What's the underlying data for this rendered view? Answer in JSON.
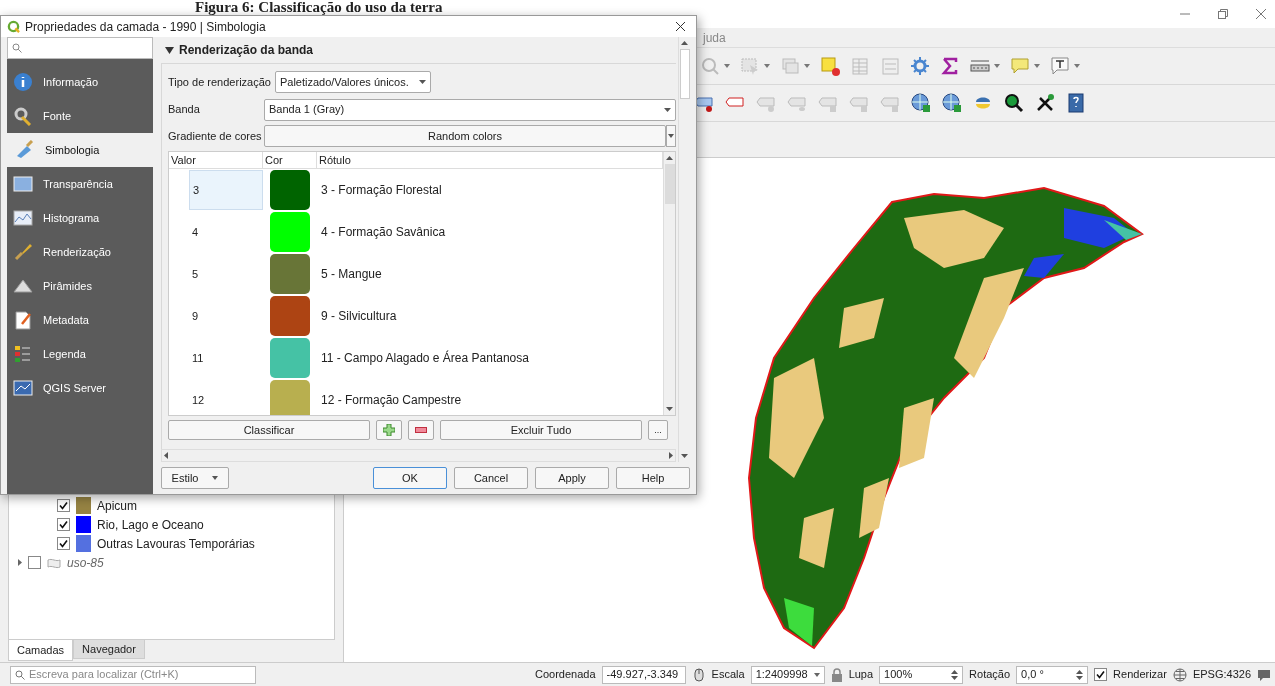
{
  "caption": "Figura 6: Classificação do uso da terra",
  "main_window": {
    "menu_fragment": "juda",
    "layers": [
      {
        "label": "Apicum",
        "checked": true,
        "color": "#968343"
      },
      {
        "label": "Rio, Lago e Oceano",
        "checked": true,
        "color": "#0000ff"
      },
      {
        "label": "Outras Lavouras Temporárias",
        "checked": true,
        "color": "#5470e0"
      }
    ],
    "layer_group": {
      "label": "uso-85",
      "checked": false,
      "expanded": false
    },
    "panel_tabs": [
      {
        "label": "Camadas",
        "selected": true
      },
      {
        "label": "Navegador",
        "selected": false
      }
    ],
    "locator": {
      "placeholder": "Escreva para localizar (Ctrl+K)"
    },
    "status_bar": {
      "coordinate_label": "Coordenada",
      "coordinate": "-49.927,-3.349",
      "scale_label": "Escala",
      "scale": "1:2409998",
      "magnifier_label": "Lupa",
      "magnifier": "100%",
      "rotation_label": "Rotação",
      "rotation": "0,0 °",
      "render": {
        "label": "Renderizar",
        "checked": true
      },
      "crs": "EPSG:4326"
    }
  },
  "dialog": {
    "title": "Propriedades da camada - 1990 | Simbologia",
    "sidebar": [
      {
        "label": "Informação",
        "selected": false
      },
      {
        "label": "Fonte",
        "selected": false
      },
      {
        "label": "Simbologia",
        "selected": true
      },
      {
        "label": "Transparência",
        "selected": false
      },
      {
        "label": "Histograma",
        "selected": false
      },
      {
        "label": "Renderização",
        "selected": false
      },
      {
        "label": "Pirâmides",
        "selected": false
      },
      {
        "label": "Metadata",
        "selected": false
      },
      {
        "label": "Legenda",
        "selected": false
      },
      {
        "label": "QGIS Server",
        "selected": false
      }
    ],
    "section": {
      "title": "Renderização da banda",
      "expanded": true
    },
    "render_type": {
      "label": "Tipo de renderização",
      "value": "Paletizado/Valores únicos."
    },
    "band": {
      "label": "Banda",
      "value": "Banda 1 (Gray)"
    },
    "gradient": {
      "label": "Gradiente de cores",
      "value": "Random colors"
    },
    "table": {
      "columns": [
        "Valor",
        "Cor",
        "Rótulo"
      ],
      "rows": [
        {
          "value": "3",
          "color": "#006400",
          "label": "3 - Formação Florestal",
          "selected": true
        },
        {
          "value": "4",
          "color": "#00ff00",
          "label": "4 - Formação Savânica",
          "selected": false
        },
        {
          "value": "5",
          "color": "#687537",
          "label": "5 - Mangue",
          "selected": false
        },
        {
          "value": "9",
          "color": "#ad4413",
          "label": "9 - Silvicultura",
          "selected": false
        },
        {
          "value": "11",
          "color": "#45c2a5",
          "label": "11 - Campo Alagado e Área Pantanosa",
          "selected": false
        },
        {
          "value": "12",
          "color": "#b8af4f",
          "label": "12 - Formação Campestre",
          "selected": false
        }
      ]
    },
    "classify_button": "Classificar",
    "delete_all_button": "Excluir Tudo",
    "more_button": "...",
    "style_button": "Estilo",
    "buttons": [
      "OK",
      "Cancel",
      "Apply",
      "Help"
    ]
  }
}
